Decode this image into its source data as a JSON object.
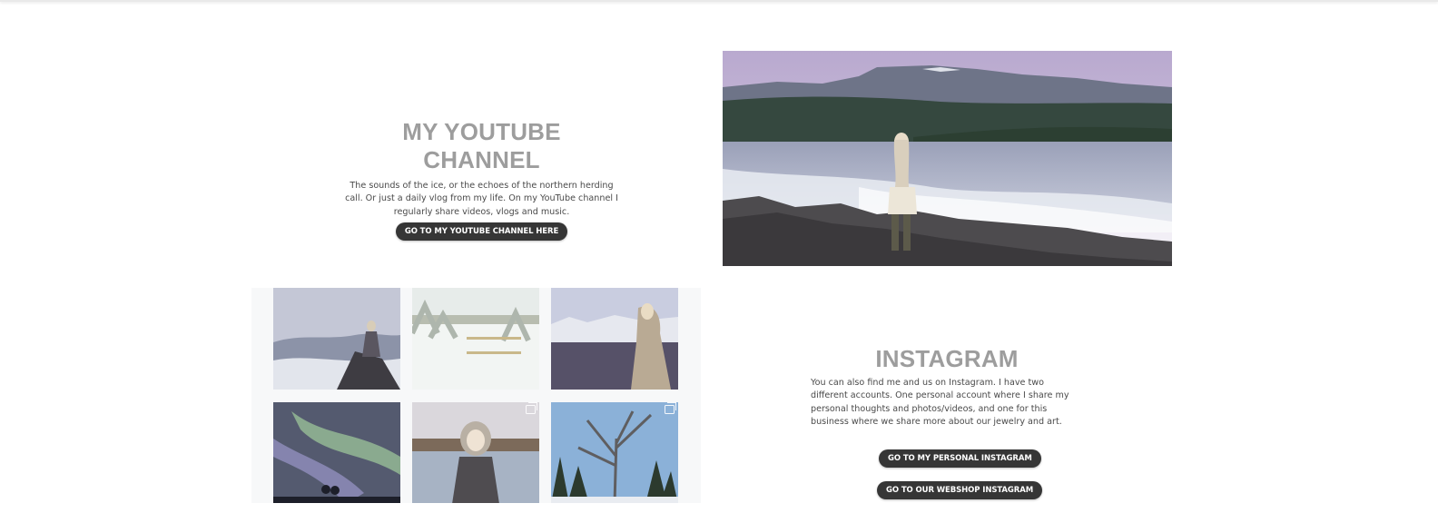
{
  "youtube": {
    "title": "MY YOUTUBE CHANNEL",
    "text": "The sounds of the ice, or the echoes of the northern herding call. Or just a daily vlog from my life. On my YouTube channel I regularly share videos, vlogs and music.",
    "button_label": "GO TO MY YOUTUBE CHANNEL HERE"
  },
  "instagram": {
    "title": "INSTAGRAM",
    "text": "You can also find me and us on Instagram. I have two different accounts. One personal account where I share my personal thoughts and photos/videos, and one for this business where we share more about our jewelry and art.",
    "personal_button_label": "GO TO MY PERSONAL INSTAGRAM",
    "webshop_button_label": "GO TO OUR WEBSHOP INSTAGRAM"
  },
  "icons": {
    "multi_photo": "multi-photo-icon"
  },
  "colors": {
    "heading": "#9d9d9d",
    "body_text": "#4a4a4a",
    "button_bg": "#363636",
    "button_text": "#ffffff"
  }
}
